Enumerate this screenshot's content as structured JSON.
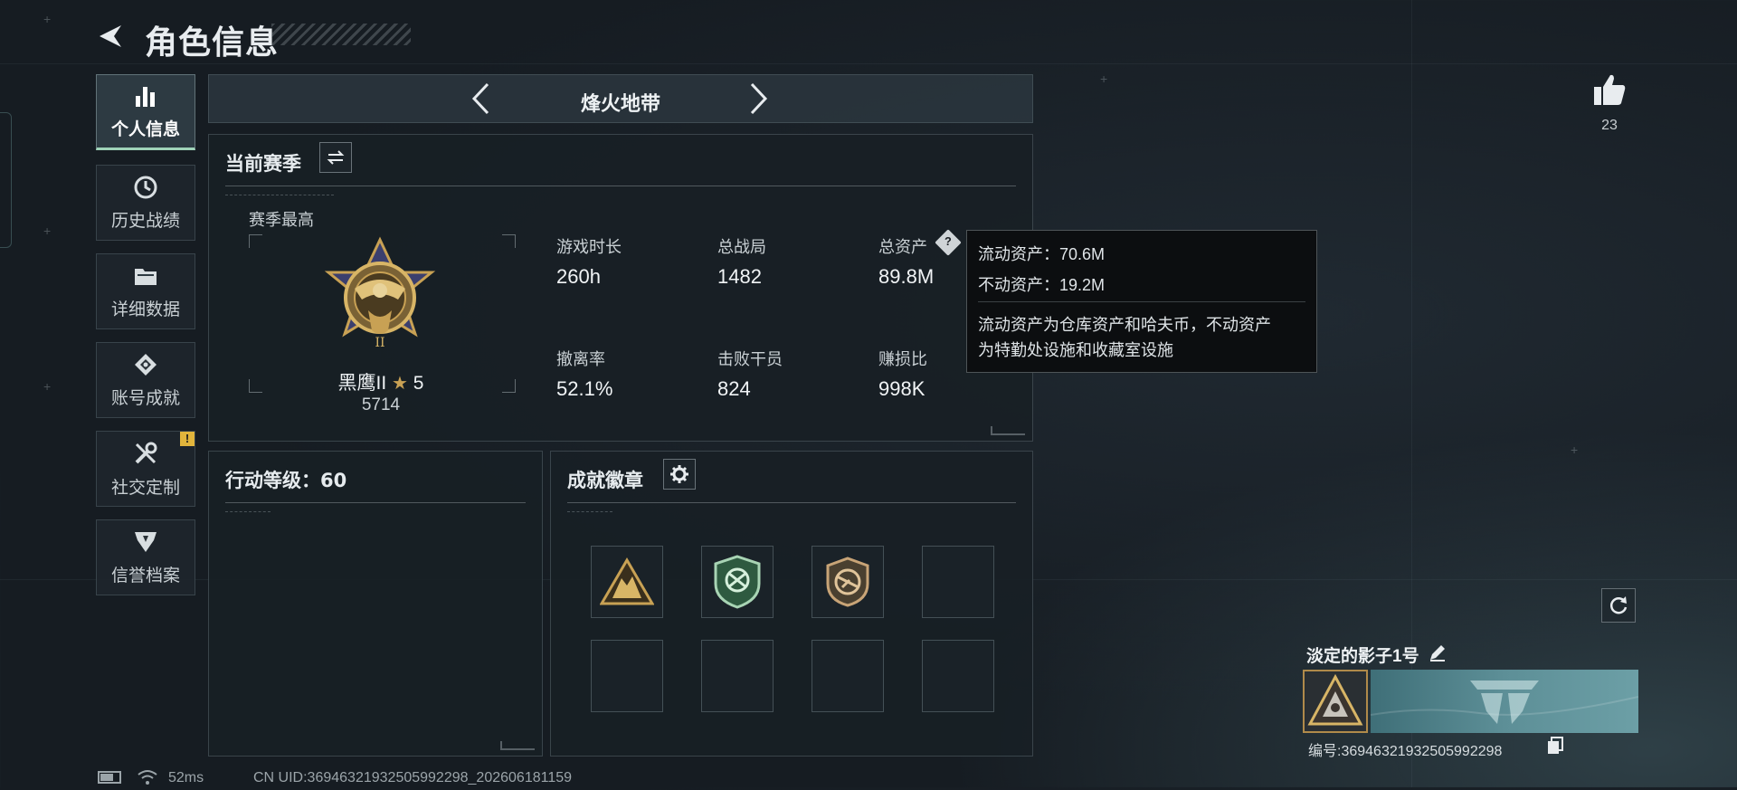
{
  "header": {
    "title": "角色信息"
  },
  "sidebar": {
    "items": [
      {
        "label": "个人信息",
        "icon": "bar-chart-icon",
        "active": true
      },
      {
        "label": "历史战绩",
        "icon": "clock-history-icon"
      },
      {
        "label": "详细数据",
        "icon": "folder-icon"
      },
      {
        "label": "账号成就",
        "icon": "achievement-emblem-icon"
      },
      {
        "label": "社交定制",
        "icon": "tools-icon",
        "badge": "!"
      },
      {
        "label": "信誉档案",
        "icon": "reputation-shield-icon"
      }
    ]
  },
  "mode": {
    "name": "烽火地带"
  },
  "season": {
    "title": "当前赛季",
    "best_label": "赛季最高",
    "rank_name": "黑鹰II",
    "rank_stars": "5",
    "rank_score": "5714",
    "stats": [
      {
        "label": "游戏时长",
        "value": "260h"
      },
      {
        "label": "总战局",
        "value": "1482"
      },
      {
        "label": "总资产",
        "value": "89.8M"
      },
      {
        "label": "撤离率",
        "value": "52.1%"
      },
      {
        "label": "击败干员",
        "value": "824"
      },
      {
        "label": "赚损比",
        "value": "998K"
      }
    ]
  },
  "tooltip": {
    "liquid": "流动资产：70.6M",
    "fixed": "不动资产：19.2M",
    "desc_line1": "流动资产为仓库资产和哈夫币，不动资产",
    "desc_line2": "为特勤处设施和收藏室设施"
  },
  "action_level": {
    "label": "行动等级：60"
  },
  "achievements": {
    "title": "成就徽章",
    "filled_slots": 3,
    "total_slots": 8
  },
  "likes": {
    "count": "23"
  },
  "player": {
    "name": "淡定的影子1号",
    "uid": "编号:36946321932505992298"
  },
  "status": {
    "ping": "52ms",
    "uid_line": "CN UID:36946321932505992298_202606181159"
  },
  "colors": {
    "accent": "#9fd3b8",
    "warning": "#e2b53c",
    "gold": "#c8a154"
  }
}
